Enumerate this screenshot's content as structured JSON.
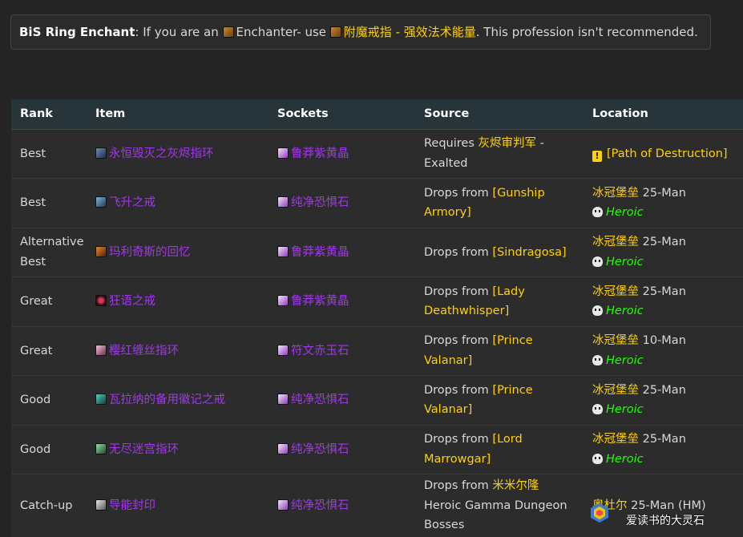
{
  "enchant": {
    "prefix": "BiS Ring Enchant",
    "text_before": ": If you are an ",
    "profession": "Enchanter",
    "text_mid": "- use ",
    "enchant_name": "附魔戒指 - 强效法术能量",
    "text_after": ". This profession isn't recommended.",
    "profession_icon": "enchanting-icon",
    "enchant_icon": "enchant-scroll-icon"
  },
  "table": {
    "headers": [
      "Rank",
      "Item",
      "Sockets",
      "Source",
      "Location"
    ],
    "rows": [
      {
        "rank": "Best",
        "item": "永恒毁灭之灰烬指环",
        "socket": "鲁莽紫黄晶",
        "source_prefix": "Requires ",
        "source_link": "灰烬审判军",
        "source_suffix": " -",
        "source_line2": "Exalted",
        "location_link": "[Path of Destruction]",
        "location_suffix": "",
        "location_mode": ""
      },
      {
        "rank": "Best",
        "item": "飞升之戒",
        "socket": "纯净恐惧石",
        "source_prefix": "Drops from ",
        "source_link": "[Gunship",
        "source_suffix": "",
        "source_line2": "Armory]",
        "location_link": "冰冠堡垒",
        "location_suffix": " 25-Man",
        "location_mode": "Heroic"
      },
      {
        "rank": "Alternative Best",
        "item": "玛利奇斯的回忆",
        "socket": "鲁莽紫黄晶",
        "source_prefix": "Drops from ",
        "source_link": "[Sindragosa]",
        "source_suffix": "",
        "source_line2": "",
        "location_link": "冰冠堡垒",
        "location_suffix": " 25-Man",
        "location_mode": "Heroic"
      },
      {
        "rank": "Great",
        "item": "狂语之戒",
        "socket": "鲁莽紫黄晶",
        "source_prefix": "Drops from ",
        "source_link": "[Lady",
        "source_suffix": "",
        "source_line2": "Deathwhisper]",
        "location_link": "冰冠堡垒",
        "location_suffix": " 25-Man",
        "location_mode": "Heroic"
      },
      {
        "rank": "Great",
        "item": "樱红缠丝指环",
        "socket": "符文赤玉石",
        "source_prefix": "Drops from ",
        "source_link": "[Prince",
        "source_suffix": "",
        "source_line2": "Valanar]",
        "location_link": "冰冠堡垒",
        "location_suffix": " 10-Man",
        "location_mode": "Heroic"
      },
      {
        "rank": "Good",
        "item": "瓦拉纳的备用徽记之戒",
        "socket": "纯净恐惧石",
        "source_prefix": "Drops from ",
        "source_link": "[Prince",
        "source_suffix": "",
        "source_line2": "Valanar]",
        "location_link": "冰冠堡垒",
        "location_suffix": " 25-Man",
        "location_mode": "Heroic"
      },
      {
        "rank": "Good",
        "item": "无尽迷宫指环",
        "socket": "纯净恐惧石",
        "source_prefix": "Drops from ",
        "source_link": "[Lord",
        "source_suffix": "",
        "source_line2": "Marrowgar]",
        "location_link": "冰冠堡垒",
        "location_suffix": " 25-Man",
        "location_mode": "Heroic"
      },
      {
        "rank": "Catch-up",
        "item": "导能封印",
        "socket": "纯净恐惧石",
        "source_prefix": "Drops from ",
        "source_link": "米米尔隆",
        "source_suffix": "",
        "source_line2": "Heroic Gamma Dungeon",
        "source_line3": "Bosses",
        "location_link": "奥杜尔",
        "location_suffix": " 25-Man (HM)",
        "location_mode": ""
      }
    ]
  },
  "watermark": {
    "text": "爱读书的大灵石"
  },
  "colors": {
    "epic": "#a335ee",
    "gold": "#ffd100",
    "heroic": "#1eff00",
    "header_bg": "#27353a",
    "row_bg": "#2c2c2c",
    "page_bg": "#242424"
  }
}
